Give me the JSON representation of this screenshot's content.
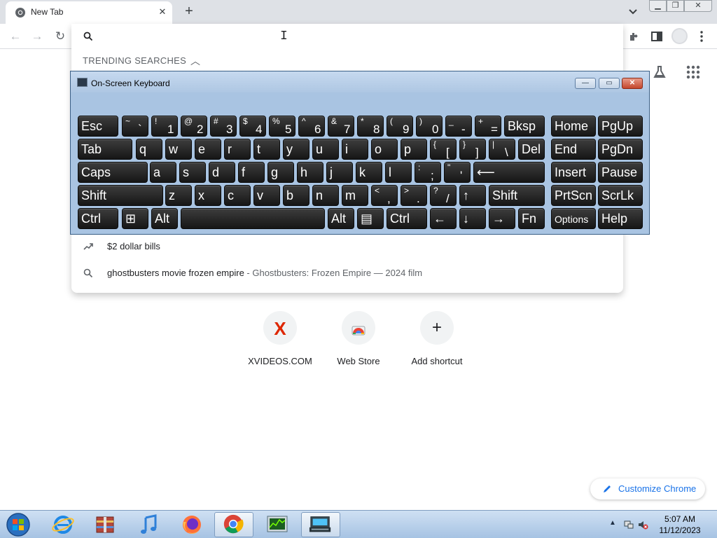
{
  "tabs": [
    {
      "title": "New Tab",
      "favicon": "chrome-icon"
    }
  ],
  "window_controls": {
    "minimize": "minimize-icon",
    "maximize": "restore-icon",
    "close": "close-icon"
  },
  "omnibox": {
    "value": "",
    "placeholder": "",
    "trending_header": "TRENDING SEARCHES",
    "suggestions": [
      {
        "icon": "trending-icon",
        "text": "$2 dollar bills",
        "subtext": ""
      },
      {
        "icon": "search-icon",
        "text": "ghostbusters movie frozen empire",
        "subtext": " - Ghostbusters: Frozen Empire — 2024 film"
      }
    ]
  },
  "osk": {
    "title": "On-Screen Keyboard",
    "rows": [
      [
        {
          "main": "Esc"
        },
        {
          "sh": "~",
          "ch": "`"
        },
        {
          "sh": "!",
          "ch": "1"
        },
        {
          "sh": "@",
          "ch": "2"
        },
        {
          "sh": "#",
          "ch": "3"
        },
        {
          "sh": "$",
          "ch": "4"
        },
        {
          "sh": "%",
          "ch": "5"
        },
        {
          "sh": "^",
          "ch": "6"
        },
        {
          "sh": "&",
          "ch": "7"
        },
        {
          "sh": "*",
          "ch": "8"
        },
        {
          "sh": "(",
          "ch": "9"
        },
        {
          "sh": ")",
          "ch": "0"
        },
        {
          "sh": "_",
          "ch": "-"
        },
        {
          "sh": "+",
          "ch": "="
        },
        {
          "main": "Bksp"
        },
        {
          "main": "Home"
        },
        {
          "main": "PgUp"
        }
      ],
      [
        {
          "main": "Tab"
        },
        {
          "main": "q"
        },
        {
          "main": "w"
        },
        {
          "main": "e"
        },
        {
          "main": "r"
        },
        {
          "main": "t"
        },
        {
          "main": "y"
        },
        {
          "main": "u"
        },
        {
          "main": "i"
        },
        {
          "main": "o"
        },
        {
          "main": "p"
        },
        {
          "sh": "{",
          "ch": "["
        },
        {
          "sh": "}",
          "ch": "]"
        },
        {
          "sh": "|",
          "ch": "\\"
        },
        {
          "main": "Del"
        },
        {
          "main": "End"
        },
        {
          "main": "PgDn"
        }
      ],
      [
        {
          "main": "Caps"
        },
        {
          "main": "a"
        },
        {
          "main": "s"
        },
        {
          "main": "d"
        },
        {
          "main": "f"
        },
        {
          "main": "g"
        },
        {
          "main": "h"
        },
        {
          "main": "j"
        },
        {
          "main": "k"
        },
        {
          "main": "l"
        },
        {
          "sh": ":",
          "ch": ";"
        },
        {
          "sh": "\"",
          "ch": "'"
        },
        {
          "main": "⟵"
        },
        {
          "main": "Insert"
        },
        {
          "main": "Pause"
        }
      ],
      [
        {
          "main": "Shift"
        },
        {
          "main": "z"
        },
        {
          "main": "x"
        },
        {
          "main": "c"
        },
        {
          "main": "v"
        },
        {
          "main": "b"
        },
        {
          "main": "n"
        },
        {
          "main": "m"
        },
        {
          "sh": "<",
          "ch": ","
        },
        {
          "sh": ">",
          "ch": "."
        },
        {
          "sh": "?",
          "ch": "/"
        },
        {
          "main": "↑"
        },
        {
          "main": "Shift"
        },
        {
          "main": "PrtScn"
        },
        {
          "main": "ScrLk"
        }
      ],
      [
        {
          "main": "Ctrl"
        },
        {
          "main": "⊞"
        },
        {
          "main": "Alt"
        },
        {
          "main": ""
        },
        {
          "main": "Alt"
        },
        {
          "main": "▤"
        },
        {
          "main": "Ctrl"
        },
        {
          "main": "←"
        },
        {
          "main": "↓"
        },
        {
          "main": "→"
        },
        {
          "main": "Fn"
        },
        {
          "main": "Options"
        },
        {
          "main": "Help"
        }
      ]
    ]
  },
  "shortcuts": [
    {
      "label": "XVIDEOS.COM",
      "icon": "xvideos-icon",
      "color": "#de2600"
    },
    {
      "label": "Web Store",
      "icon": "webstore-icon"
    },
    {
      "label": "Add shortcut",
      "icon": "plus-icon"
    }
  ],
  "customize": {
    "label": "Customize Chrome"
  },
  "taskbar": {
    "apps": [
      "internet-explorer-icon",
      "archive-icon",
      "itunes-icon",
      "firefox-icon",
      "chrome-icon",
      "task-manager-icon",
      "osk-icon"
    ],
    "active_app": "chrome-icon",
    "clock_time": "5:07 AM",
    "clock_date": "11/12/2023"
  }
}
